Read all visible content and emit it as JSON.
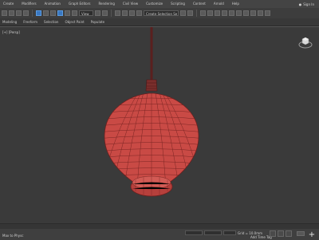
{
  "menu": {
    "items": [
      "Create",
      "Modifiers",
      "Animation",
      "Graph Editors",
      "Rendering",
      "Civil View",
      "Customize",
      "Scripting",
      "Content",
      "Arnold",
      "Help"
    ],
    "sign_in": "Sign In"
  },
  "toolbar": {
    "view_select": "View",
    "selection_set": "Create Selection Se"
  },
  "ribbon": {
    "tabs": [
      "Modeling",
      "Freeform",
      "Selection",
      "Object Paint",
      "Populate"
    ]
  },
  "viewport": {
    "label": "[+] [Persp]"
  },
  "status": {
    "message": "Max to Physc",
    "grid": "Grid = 10.0mm",
    "add_time_tag": "Add Time Tag"
  },
  "colors": {
    "mesh": "#c94a45",
    "wire": "#6e1f1e",
    "viewport_bg": "#3a3a3a"
  }
}
